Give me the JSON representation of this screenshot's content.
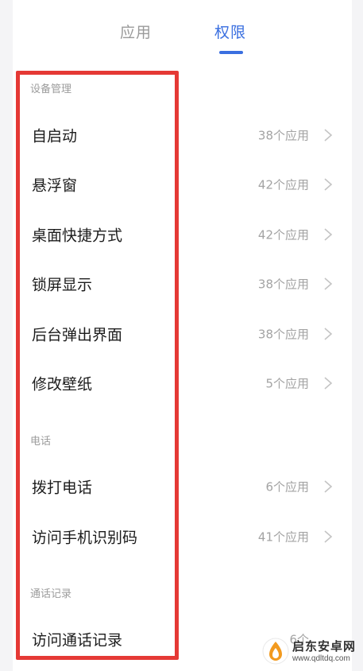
{
  "tabs": [
    {
      "label": "应用",
      "active": false
    },
    {
      "label": "权限",
      "active": true
    }
  ],
  "sections": [
    {
      "title": "设备管理",
      "items": [
        {
          "label": "自启动",
          "count": "38个应用"
        },
        {
          "label": "悬浮窗",
          "count": "42个应用"
        },
        {
          "label": "桌面快捷方式",
          "count": "42个应用"
        },
        {
          "label": "锁屏显示",
          "count": "38个应用"
        },
        {
          "label": "后台弹出界面",
          "count": "38个应用"
        },
        {
          "label": "修改壁纸",
          "count": "5个应用"
        }
      ]
    },
    {
      "title": "电话",
      "items": [
        {
          "label": "拨打电话",
          "count": "6个应用"
        },
        {
          "label": "访问手机识别码",
          "count": "41个应用"
        }
      ]
    },
    {
      "title": "通话记录",
      "items": [
        {
          "label": "访问通话记录",
          "count": "6个"
        }
      ]
    }
  ],
  "watermark": {
    "name": "启东安卓网",
    "url": "www.qdltdq.com"
  },
  "colors": {
    "accent": "#3a6fe0",
    "highlight": "#e53935"
  }
}
